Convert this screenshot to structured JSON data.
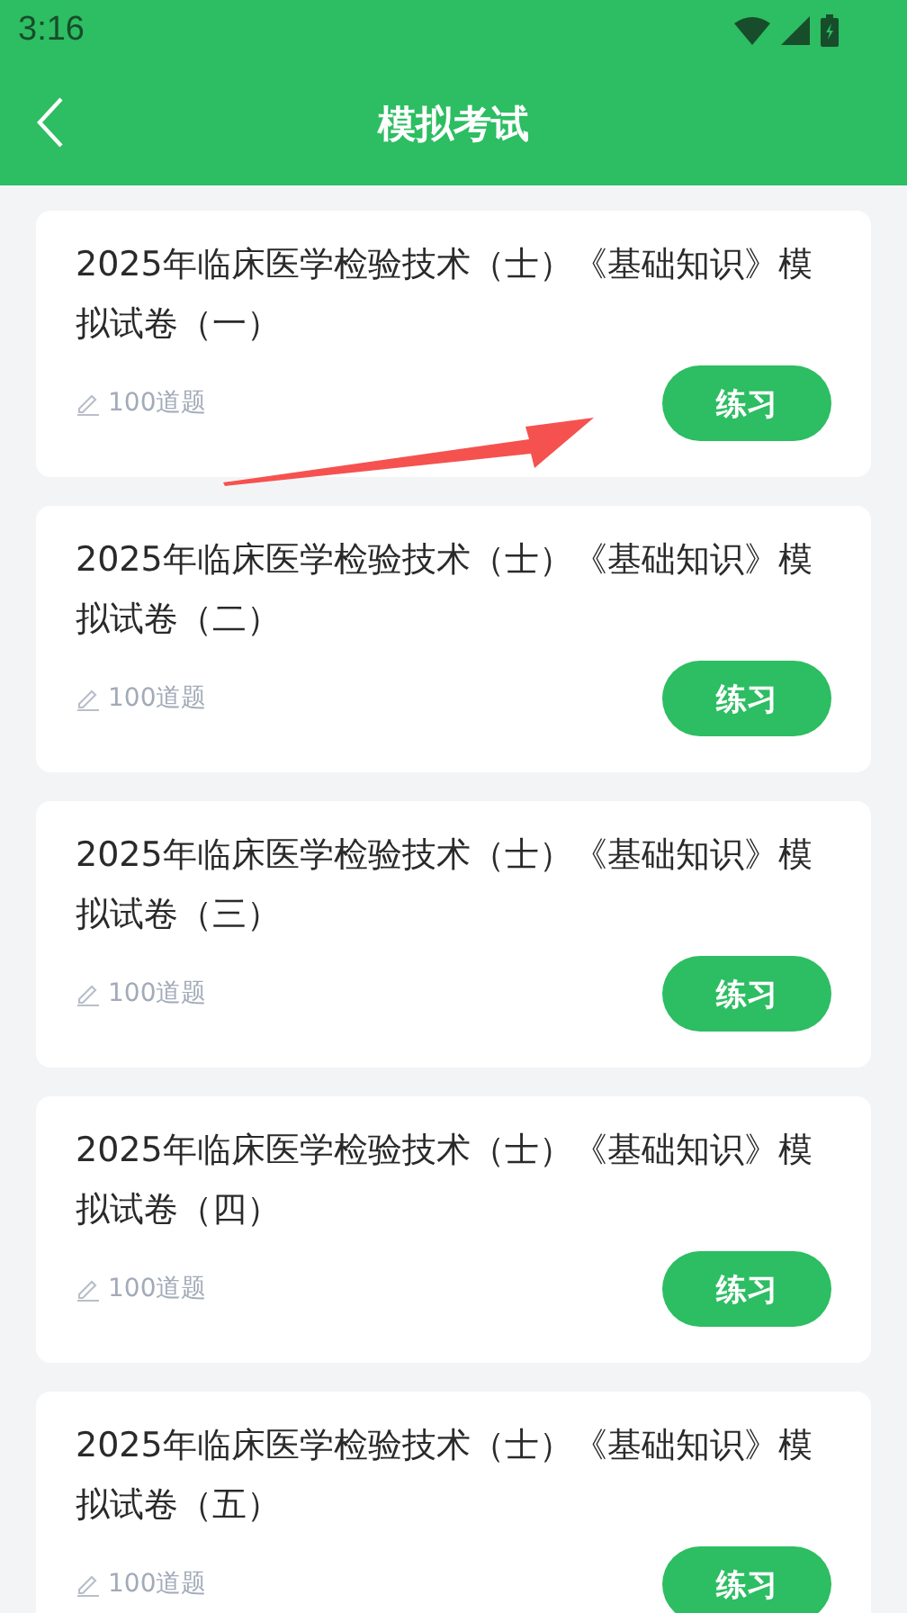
{
  "status_bar": {
    "time": "3:16"
  },
  "header": {
    "title": "模拟考试"
  },
  "exams": [
    {
      "title": "2025年临床医学检验技术（士）《基础知识》模拟试卷（一）",
      "question_count": "100道题",
      "button": "练习"
    },
    {
      "title": "2025年临床医学检验技术（士）《基础知识》模拟试卷（二）",
      "question_count": "100道题",
      "button": "练习"
    },
    {
      "title": "2025年临床医学检验技术（士）《基础知识》模拟试卷（三）",
      "question_count": "100道题",
      "button": "练习"
    },
    {
      "title": "2025年临床医学检验技术（士）《基础知识》模拟试卷（四）",
      "question_count": "100道题",
      "button": "练习"
    },
    {
      "title": "2025年临床医学检验技术（士）《基础知识》模拟试卷（五）",
      "question_count": "100道题",
      "button": "练习"
    }
  ]
}
